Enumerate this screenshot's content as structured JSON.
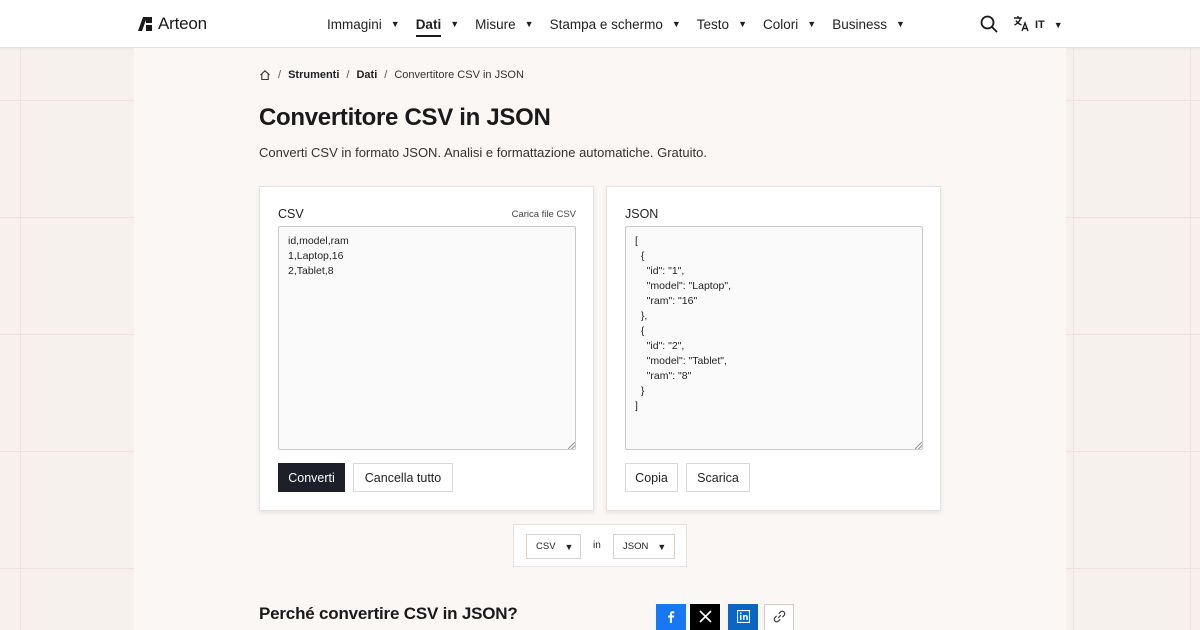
{
  "header": {
    "logo_text": "Arteon",
    "nav": [
      {
        "label": "Immagini",
        "active": false
      },
      {
        "label": "Dati",
        "active": true
      },
      {
        "label": "Misure",
        "active": false
      },
      {
        "label": "Stampa e schermo",
        "active": false
      },
      {
        "label": "Testo",
        "active": false
      },
      {
        "label": "Colori",
        "active": false
      },
      {
        "label": "Business",
        "active": false
      }
    ],
    "language": "IT"
  },
  "breadcrumb": {
    "items": [
      "Strumenti",
      "Dati"
    ],
    "current": "Convertitore CSV in JSON"
  },
  "page": {
    "title": "Convertitore CSV in JSON",
    "description": "Converti CSV in formato JSON. Analisi e formattazione automatiche. Gratuito."
  },
  "input_panel": {
    "label": "CSV",
    "upload_label": "Carica file CSV",
    "value": "id,model,ram\n1,Laptop,16\n2,Tablet,8",
    "convert_label": "Converti",
    "clear_label": "Cancella tutto"
  },
  "output_panel": {
    "label": "JSON",
    "value": "[\n  {\n    \"id\": \"1\",\n    \"model\": \"Laptop\",\n    \"ram\": \"16\"\n  },\n  {\n    \"id\": \"2\",\n    \"model\": \"Tablet\",\n    \"ram\": \"8\"\n  }\n]",
    "copy_label": "Copia",
    "download_label": "Scarica"
  },
  "format_bar": {
    "from": "CSV",
    "joiner": "in",
    "to": "JSON"
  },
  "section": {
    "title": "Perché convertire CSV in JSON?"
  },
  "share": {
    "icons": [
      "facebook-icon",
      "x-icon",
      "linkedin-icon",
      "link-icon"
    ],
    "colors": {
      "facebook": "#1877f2",
      "x": "#000000",
      "linkedin": "#0a66c2"
    }
  },
  "colors": {
    "primary_button": "#1d1f2b",
    "page_background": "#f6f1ec"
  }
}
